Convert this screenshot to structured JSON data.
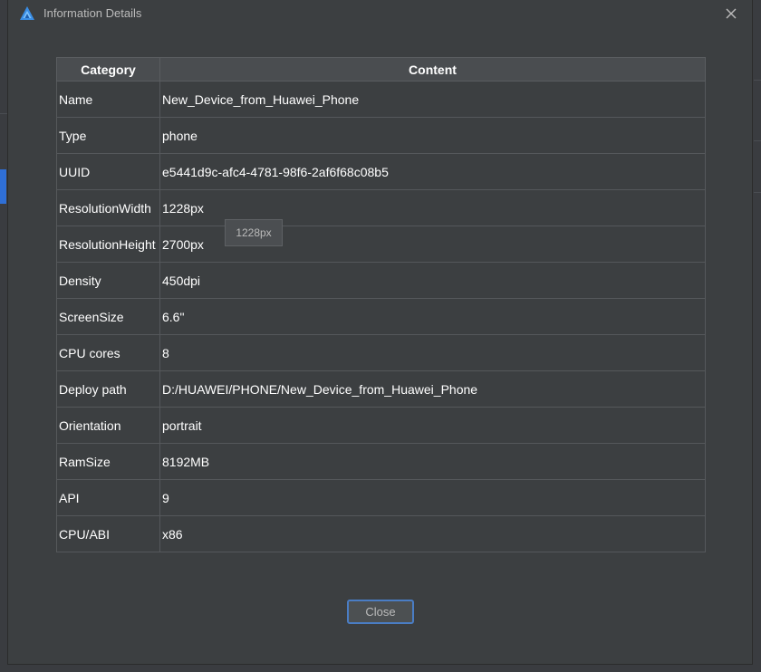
{
  "window": {
    "title": "Information Details",
    "icon": "huawei-devtools-logo",
    "close_icon": "close-icon"
  },
  "table": {
    "headers": [
      "Category",
      "Content"
    ],
    "rows": [
      {
        "category": "Name",
        "content": "New_Device_from_Huawei_Phone"
      },
      {
        "category": "Type",
        "content": "phone"
      },
      {
        "category": "UUID",
        "content": "e5441d9c-afc4-4781-98f6-2af6f68c08b5"
      },
      {
        "category": "ResolutionWidth",
        "content": "1228px"
      },
      {
        "category": "ResolutionHeight",
        "content": "2700px"
      },
      {
        "category": "Density",
        "content": "450dpi"
      },
      {
        "category": "ScreenSize",
        "content": "6.6\""
      },
      {
        "category": "CPU cores",
        "content": "8"
      },
      {
        "category": "Deploy path",
        "content": "D:/HUAWEI/PHONE/New_Device_from_Huawei_Phone"
      },
      {
        "category": "Orientation",
        "content": "portrait"
      },
      {
        "category": "RamSize",
        "content": "8192MB"
      },
      {
        "category": "API",
        "content": "9"
      },
      {
        "category": "CPU/ABI",
        "content": "x86"
      }
    ]
  },
  "tooltip": {
    "text": "1228px"
  },
  "footer": {
    "close_label": "Close"
  },
  "colors": {
    "dialog_bg": "#3c3f41",
    "header_bg": "#4a4d50",
    "accent_border": "#4a7dc4",
    "text": "#ffffff"
  }
}
